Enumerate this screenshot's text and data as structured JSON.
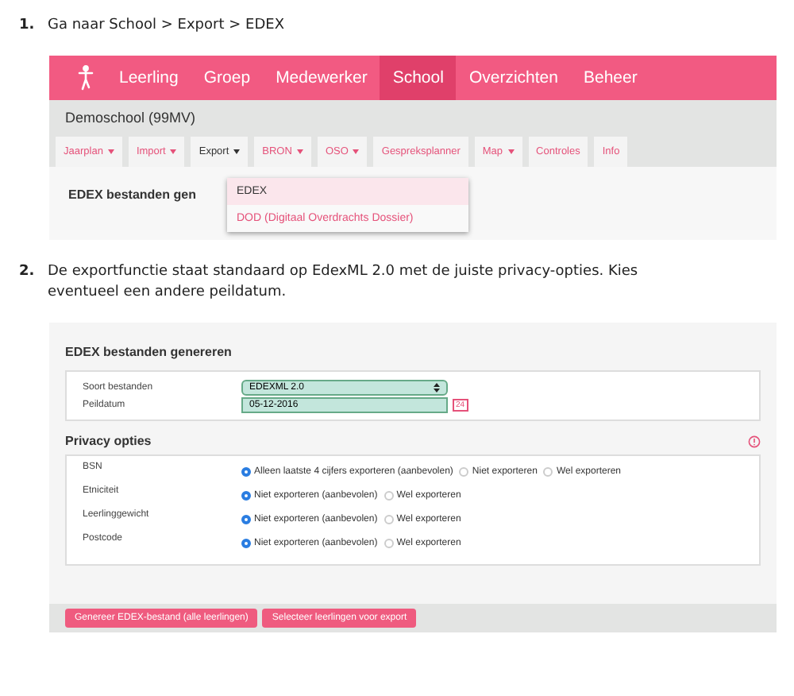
{
  "steps": [
    {
      "number": "1.",
      "text": "Ga naar School > Export > EDEX",
      "screen": {
        "kind": "menu",
        "nav": [
          {
            "label": "Leerling",
            "selected": false
          },
          {
            "label": "Groep",
            "selected": false
          },
          {
            "label": "Medewerker",
            "selected": false
          },
          {
            "label": "School",
            "selected": true
          },
          {
            "label": "Overzichten",
            "selected": false
          },
          {
            "label": "Beheer",
            "selected": false
          }
        ],
        "school": "Demoschool (99MV)",
        "tabs": [
          {
            "label": "Jaarplan",
            "dropdown": true,
            "selected": false
          },
          {
            "label": "Import",
            "dropdown": true,
            "selected": false
          },
          {
            "label": "Export",
            "dropdown": true,
            "selected": true
          },
          {
            "label": "BRON",
            "dropdown": true,
            "selected": false
          },
          {
            "label": "OSO",
            "dropdown": true,
            "selected": false
          },
          {
            "label": "Gespreksplanner",
            "dropdown": false,
            "selected": false
          },
          {
            "label": "Map",
            "dropdown": true,
            "selected": false
          },
          {
            "label": "Controles",
            "dropdown": false,
            "selected": false
          },
          {
            "label": "Info",
            "dropdown": false,
            "selected": false
          }
        ],
        "heading": "EDEX bestanden gen",
        "menu": [
          {
            "label": "EDEX",
            "selected": true
          },
          {
            "label": "DOD (Digitaal Overdrachts Dossier)",
            "selected": false
          }
        ]
      }
    },
    {
      "number": "2.",
      "text": "De exportfunctie staat standaard op EdexML 2.0 met de juiste privacy-opties. Kies eventueel een andere peildatum.",
      "screen": {
        "kind": "form",
        "title": "EDEX bestanden genereren",
        "fields": [
          {
            "label": "Soort bestanden",
            "kind": "select",
            "value": "EDEXML 2.0"
          },
          {
            "label": "Peildatum",
            "kind": "date",
            "value": "05-12-2016",
            "calendar": "24"
          }
        ],
        "privacy_title": "Privacy opties",
        "privacy": [
          {
            "label": "BSN",
            "options": [
              {
                "label": "Alleen laatste 4 cijfers exporteren (aanbevolen)",
                "selected": true
              },
              {
                "label": "Niet exporteren",
                "selected": false
              },
              {
                "label": "Wel exporteren",
                "selected": false
              }
            ]
          },
          {
            "label": "Etniciteit",
            "options": [
              {
                "label": "Niet exporteren (aanbevolen)",
                "selected": true
              },
              {
                "label": "Wel exporteren",
                "selected": false
              }
            ]
          },
          {
            "label": "Leerlinggewicht",
            "options": [
              {
                "label": "Niet exporteren (aanbevolen)",
                "selected": true
              },
              {
                "label": "Wel exporteren",
                "selected": false
              }
            ]
          },
          {
            "label": "Postcode",
            "options": [
              {
                "label": "Niet exporteren (aanbevolen)",
                "selected": true
              },
              {
                "label": "Wel exporteren",
                "selected": false
              }
            ]
          }
        ],
        "buttons": [
          "Genereer EDEX-bestand (alle leerlingen)",
          "Selecteer leerlingen voor export"
        ]
      }
    }
  ]
}
